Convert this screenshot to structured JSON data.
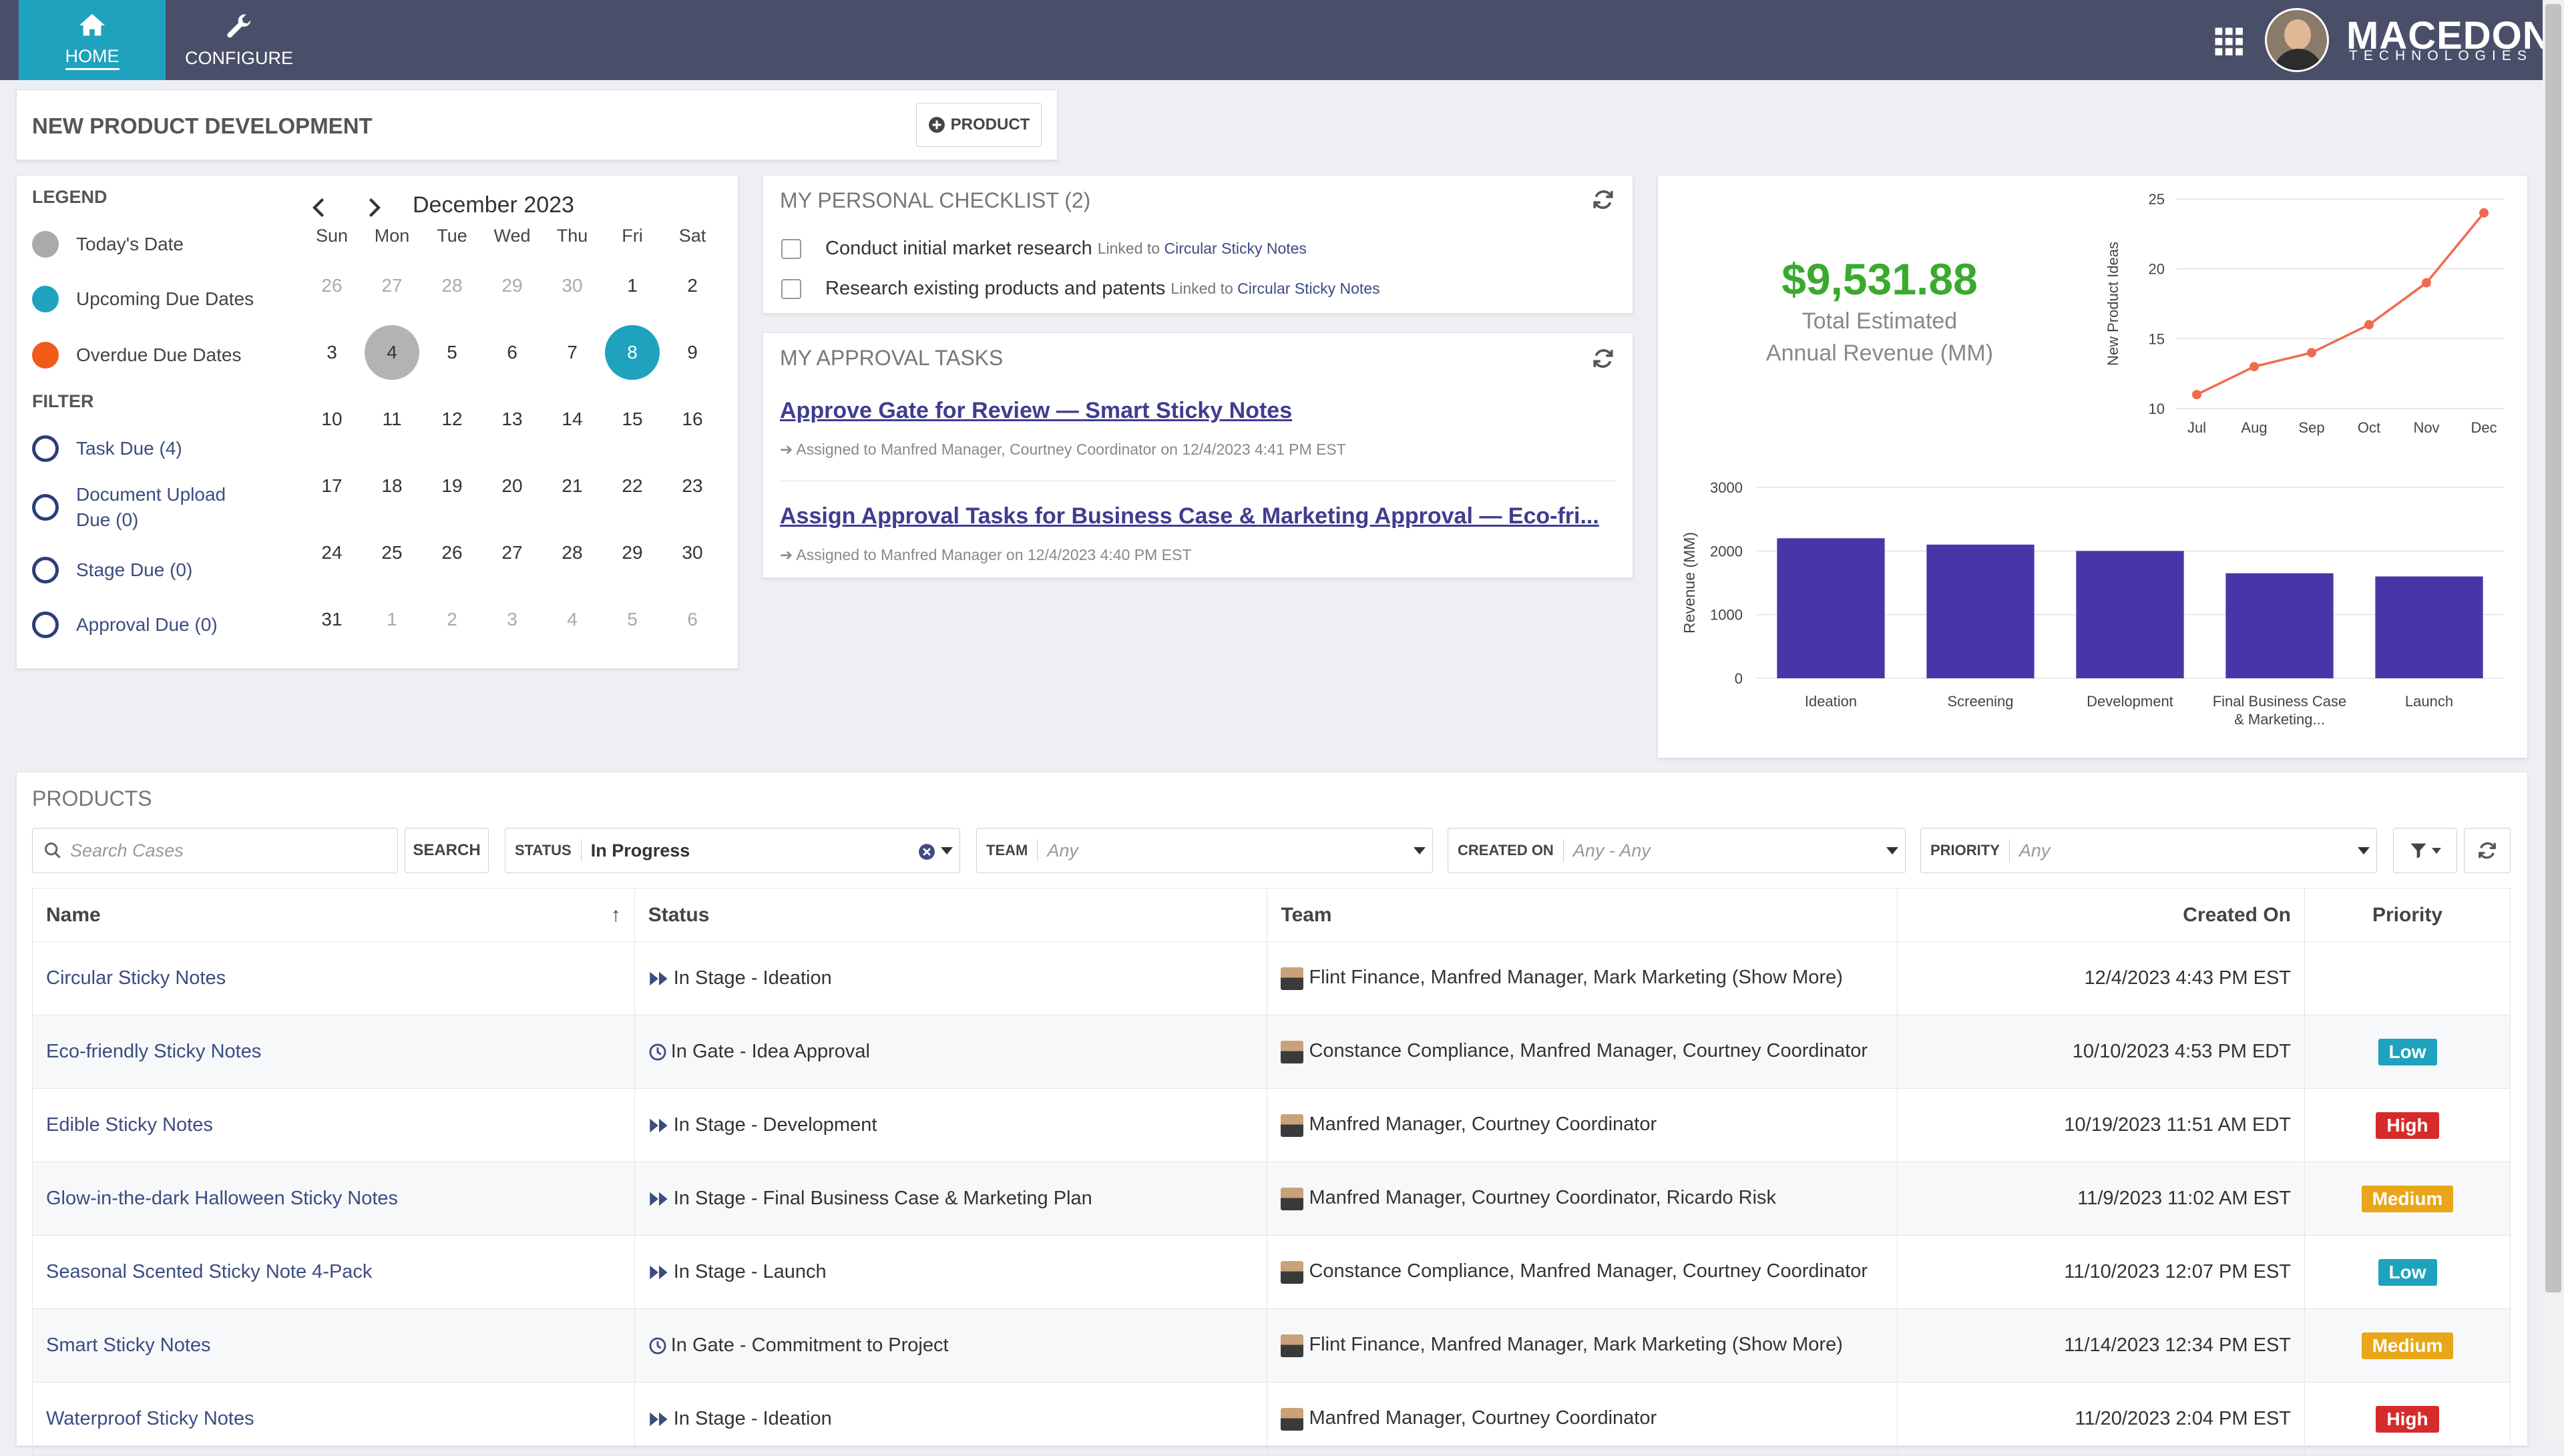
{
  "nav": {
    "home": "HOME",
    "configure": "CONFIGURE"
  },
  "brand": {
    "name": "MACEDON",
    "sub": "TECHNOLOGIES"
  },
  "header": {
    "title": "NEW PRODUCT DEVELOPMENT",
    "product_button": "PRODUCT"
  },
  "legend": {
    "title": "LEGEND",
    "items": [
      "Today's Date",
      "Upcoming Due Dates",
      "Overdue Due Dates"
    ],
    "filter_title": "FILTER",
    "filters": [
      "Task Due (4)",
      "Document Upload Due (0)",
      "Stage Due (0)",
      "Approval Due (0)"
    ]
  },
  "calendar": {
    "month": "December 2023",
    "weekdays": [
      "Sun",
      "Mon",
      "Tue",
      "Wed",
      "Thu",
      "Fri",
      "Sat"
    ],
    "weeks": [
      [
        "26",
        "27",
        "28",
        "29",
        "30",
        "1",
        "2"
      ],
      [
        "3",
        "4",
        "5",
        "6",
        "7",
        "8",
        "9"
      ],
      [
        "10",
        "11",
        "12",
        "13",
        "14",
        "15",
        "16"
      ],
      [
        "17",
        "18",
        "19",
        "20",
        "21",
        "22",
        "23"
      ],
      [
        "24",
        "25",
        "26",
        "27",
        "28",
        "29",
        "30"
      ],
      [
        "31",
        "1",
        "2",
        "3",
        "4",
        "5",
        "6"
      ]
    ]
  },
  "checklist": {
    "title": "MY PERSONAL CHECKLIST (2)",
    "items": [
      {
        "text": "Conduct initial market research",
        "linked": "Linked to",
        "link": "Circular Sticky Notes"
      },
      {
        "text": "Research existing products and patents",
        "linked": "Linked to",
        "link": "Circular Sticky Notes"
      }
    ]
  },
  "approvals": {
    "title": "MY APPROVAL TASKS",
    "items": [
      {
        "title": "Approve Gate for Review — Smart Sticky Notes",
        "sub": "Assigned to Manfred Manager, Courtney Coordinator on 12/4/2023 4:41 PM  EST"
      },
      {
        "title": "Assign Approval Tasks for Business Case & Marketing Approval — Eco-fri...",
        "sub": "Assigned to Manfred Manager on 12/4/2023 4:40 PM  EST"
      }
    ]
  },
  "revenue": {
    "value": "$9,531.88",
    "label1": "Total Estimated",
    "label2": "Annual Revenue (MM)"
  },
  "chart_data": [
    {
      "type": "line",
      "categories": [
        "Jul",
        "Aug",
        "Sep",
        "Oct",
        "Nov",
        "Dec"
      ],
      "values": [
        11,
        13,
        14,
        16,
        19,
        24
      ],
      "ylabel": "New Product Ideas",
      "ylim": [
        10,
        25
      ],
      "yticks": [
        "10",
        "15",
        "20",
        "25"
      ],
      "color": "#f06a4e",
      "grid": true
    },
    {
      "type": "bar",
      "categories": [
        "Ideation",
        "Screening",
        "Development",
        "Final Business Case & Marketing...",
        "Launch"
      ],
      "cat_lines": [
        [
          "Ideation"
        ],
        [
          "Screening"
        ],
        [
          "Development"
        ],
        [
          "Final Business Case",
          "& Marketing..."
        ],
        [
          "Launch"
        ]
      ],
      "values": [
        2200,
        2100,
        2000,
        1650,
        1600
      ],
      "ylabel": "Revenue (MM)",
      "ylim": [
        0,
        3000
      ],
      "yticks": [
        "0",
        "1000",
        "2000",
        "3000"
      ],
      "color": "#4a35a8",
      "grid": true
    }
  ],
  "products": {
    "title": "PRODUCTS",
    "search_placeholder": "Search Cases",
    "search_button": "SEARCH",
    "filters": {
      "status_label": "STATUS",
      "status_value": "In Progress",
      "team_label": "TEAM",
      "team_value": "Any",
      "created_label": "CREATED ON",
      "created_value": "Any - Any",
      "priority_label": "PRIORITY",
      "priority_value": "Any"
    },
    "columns": [
      "Name",
      "Status",
      "Team",
      "Created On",
      "Priority"
    ],
    "rows": [
      {
        "name": "Circular Sticky Notes",
        "status": "In Stage - Ideation",
        "status_icon": "stage",
        "team": "Flint Finance,  Manfred Manager,  Mark Marketing (Show More)",
        "created": "12/4/2023 4:43 PM  EST",
        "priority": "",
        "pcolor": ""
      },
      {
        "name": "Eco-friendly Sticky Notes",
        "status": "In Gate - Idea Approval",
        "status_icon": "gate",
        "team": "Constance Compliance,  Manfred Manager,  Courtney Coordinator",
        "created": "10/10/2023 4:53 PM  EDT",
        "priority": "Low",
        "pcolor": "#1fa2bd"
      },
      {
        "name": "Edible Sticky Notes",
        "status": "In Stage - Development",
        "status_icon": "stage",
        "team": "Manfred Manager,  Courtney Coordinator",
        "created": "10/19/2023 11:51 AM  EDT",
        "priority": "High",
        "pcolor": "#d62b2b"
      },
      {
        "name": "Glow-in-the-dark Halloween Sticky Notes",
        "status": "In Stage - Final Business Case & Marketing Plan",
        "status_icon": "stage",
        "team": "Manfred Manager,  Courtney Coordinator,  Ricardo Risk",
        "created": "11/9/2023 11:02 AM  EST",
        "priority": "Medium",
        "pcolor": "#e8a618"
      },
      {
        "name": "Seasonal Scented Sticky Note 4-Pack",
        "status": "In Stage - Launch",
        "status_icon": "stage",
        "team": "Constance Compliance,  Manfred Manager,  Courtney Coordinator",
        "created": "11/10/2023 12:07 PM  EST",
        "priority": "Low",
        "pcolor": "#1fa2bd"
      },
      {
        "name": "Smart Sticky Notes",
        "status": "In Gate - Commitment to Project",
        "status_icon": "gate",
        "team": "Flint Finance,  Manfred Manager,  Mark Marketing (Show More)",
        "created": "11/14/2023 12:34 PM  EST",
        "priority": "Medium",
        "pcolor": "#e8a618"
      },
      {
        "name": "Waterproof Sticky Notes",
        "status": "In Stage - Ideation",
        "status_icon": "stage",
        "team": "Manfred Manager,  Courtney Coordinator",
        "created": "11/20/2023 2:04 PM  EST",
        "priority": "High",
        "pcolor": "#d62b2b"
      }
    ]
  }
}
